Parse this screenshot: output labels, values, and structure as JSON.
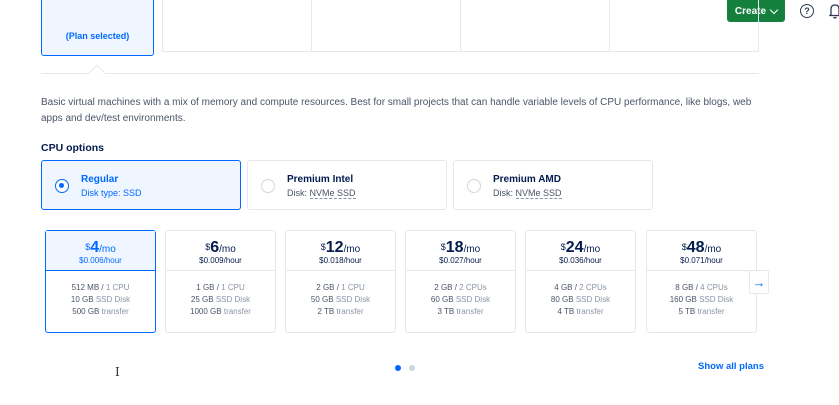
{
  "topbar": {
    "create_label": "Create",
    "help_glyph": "?"
  },
  "plan_tabs": {
    "selected_label": "(Plan selected)"
  },
  "description": "Basic virtual machines with a mix of memory and compute resources. Best for small projects that can handle variable levels of CPU performance, like blogs, web apps and dev/test environments.",
  "cpu": {
    "title": "CPU options",
    "options": [
      {
        "name": "Regular",
        "disk_prefix": "Disk type: ",
        "disk": "SSD",
        "selected": true
      },
      {
        "name": "Premium Intel",
        "disk_prefix": "Disk: ",
        "disk": "NVMe SSD",
        "selected": false
      },
      {
        "name": "Premium AMD",
        "disk_prefix": "Disk: ",
        "disk": "NVMe SSD",
        "selected": false
      }
    ]
  },
  "prices": [
    {
      "currency": "$",
      "amount": "4",
      "per": "/mo",
      "hourly": "$0.006/hour",
      "mem": "512 MB",
      "cpu": "1 CPU",
      "disk": "10 GB",
      "disk_type": "SSD Disk",
      "transfer": "500 GB",
      "transfer_label": "transfer",
      "selected": true
    },
    {
      "currency": "$",
      "amount": "6",
      "per": "/mo",
      "hourly": "$0.009/hour",
      "mem": "1 GB",
      "cpu": "1 CPU",
      "disk": "25 GB",
      "disk_type": "SSD Disk",
      "transfer": "1000 GB",
      "transfer_label": "transfer",
      "selected": false
    },
    {
      "currency": "$",
      "amount": "12",
      "per": "/mo",
      "hourly": "$0.018/hour",
      "mem": "2 GB",
      "cpu": "1 CPU",
      "disk": "50 GB",
      "disk_type": "SSD Disk",
      "transfer": "2 TB",
      "transfer_label": "transfer",
      "selected": false
    },
    {
      "currency": "$",
      "amount": "18",
      "per": "/mo",
      "hourly": "$0.027/hour",
      "mem": "2 GB",
      "cpu": "2 CPUs",
      "disk": "60 GB",
      "disk_type": "SSD Disk",
      "transfer": "3 TB",
      "transfer_label": "transfer",
      "selected": false
    },
    {
      "currency": "$",
      "amount": "24",
      "per": "/mo",
      "hourly": "$0.036/hour",
      "mem": "4 GB",
      "cpu": "2 CPUs",
      "disk": "80 GB",
      "disk_type": "SSD Disk",
      "transfer": "4 TB",
      "transfer_label": "transfer",
      "selected": false
    },
    {
      "currency": "$",
      "amount": "48",
      "per": "/mo",
      "hourly": "$0.071/hour",
      "mem": "8 GB",
      "cpu": "4 CPUs",
      "disk": "160 GB",
      "disk_type": "SSD Disk",
      "transfer": "5 TB",
      "transfer_label": "transfer",
      "selected": false
    }
  ],
  "carousel": {
    "next_glyph": "→",
    "active_page": 1,
    "pages": 2
  },
  "show_all_label": "Show all plans",
  "colors": {
    "accent": "#0069ff",
    "create_green": "#15803d",
    "text": "#031b4e"
  }
}
